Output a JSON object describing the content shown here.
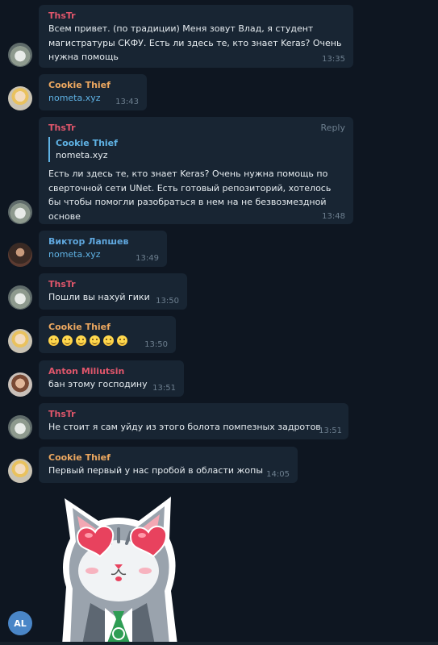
{
  "messages": [
    {
      "sender": "ThsTr",
      "text": "Всем привет. (по традиции) Меня зовут Влад, я студент магистратуры СКФУ. Есть ли здесь те, кто знает Keras? Очень нужна помощь",
      "time": "13:35"
    },
    {
      "sender": "Cookie Thief",
      "link": "nometa.xyz",
      "time": "13:43"
    },
    {
      "sender": "ThsTr",
      "reply_label": "Reply",
      "quote_name": "Cookie Thief",
      "quote_text": "nometa.xyz",
      "text": "Есть ли здесь те, кто знает Keras? Очень нужна помощь по сверточной сети UNet. Есть готовый репозиторий, хотелось бы чтобы помогли разобраться в нем на не безвозмездной основе",
      "time": "13:48"
    },
    {
      "sender": "Виктор Лапшев",
      "link": "nometa.xyz",
      "time": "13:49"
    },
    {
      "sender": "ThsTr",
      "text": "Пошли вы нахуй гики",
      "time": "13:50"
    },
    {
      "sender": "Cookie Thief",
      "emoji": [
        "grinning-emoji",
        "grinning-emoji",
        "grinning-emoji",
        "grinning-emoji",
        "grinning-emoji",
        "grinning-emoji"
      ],
      "time": "13:50"
    },
    {
      "sender": "Anton Miliutsin",
      "text": "бан этому господину",
      "time": "13:51"
    },
    {
      "sender": "ThsTr",
      "text": "Не стоит я сам уйду из этого болота помпезных задротов",
      "time": "13:51"
    },
    {
      "sender": "Cookie Thief",
      "text": "Первый первый у нас пробой в области жопы",
      "time": "14:05"
    }
  ],
  "sticker": {
    "name": "cat-in-love-sticker"
  },
  "self_avatar": {
    "initials": "AL"
  },
  "colors": {
    "background": "#0e1621",
    "bubble": "#182533",
    "name_thstr": "#e0566b",
    "name_cookie": "#eda860",
    "name_viktor": "#5fa7de",
    "link": "#5fb2e4",
    "timestamp": "#6d7f8f"
  }
}
